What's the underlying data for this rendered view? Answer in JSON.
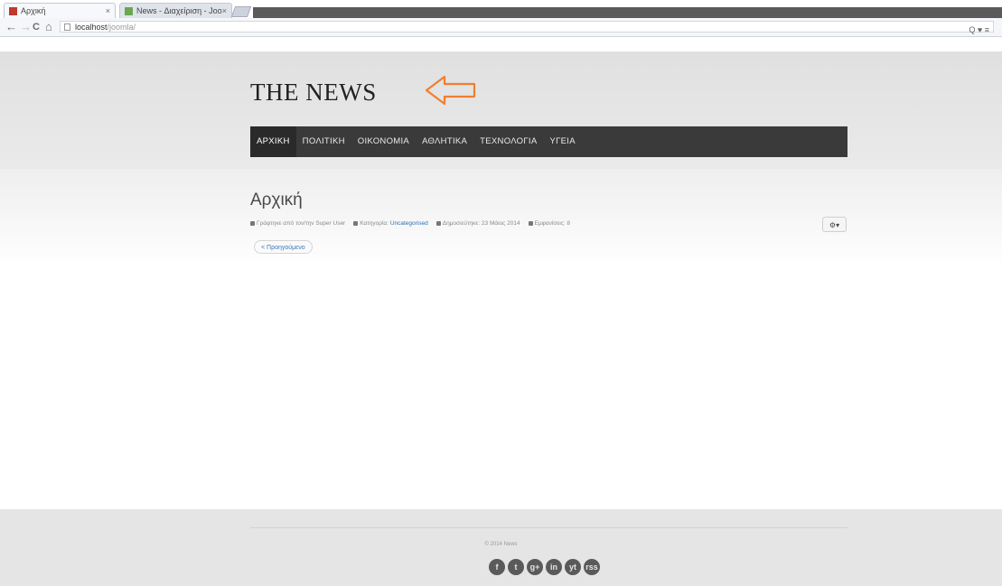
{
  "browser": {
    "tabs": [
      {
        "title": "Αρχική",
        "favicon_color": "#c0392b"
      },
      {
        "title": "News - Διαχείριση - Joo",
        "favicon_color": "#6aa84f"
      }
    ],
    "url_host": "localhost",
    "url_path": "/joomla/",
    "nav": {
      "back": "←",
      "forward": "→",
      "reload": "C",
      "home": "⌂"
    },
    "right_icons": "Q ♥ ≡"
  },
  "site": {
    "logo": "THE NEWS",
    "arrow_color": "#f07f2f",
    "nav": [
      "ΑΡΧΙΚΗ",
      "ΠΟΛΙΤΙΚΗ",
      "ΟΙΚΟΝΟΜΙΑ",
      "ΑΘΛΗΤΙΚΑ",
      "ΤΕΧΝΟΛΟΓΙΑ",
      "ΥΓΕΙΑ"
    ],
    "nav_active": 0
  },
  "article": {
    "title": "Αρχική",
    "meta": {
      "author": "Γράφτηκε από τον/την Super User",
      "category_label": "Κατηγορία:",
      "category_value": "Uncategorised",
      "published": "Δημοσιεύτηκε: 23 Μάιος 2014",
      "hits": "Εμφανίσεις: 8"
    },
    "tools_label": "⚙▾",
    "back_label": "< Προηγούμενο"
  },
  "footer": {
    "copyright": "© 2014 News",
    "social": [
      "f",
      "t",
      "g+",
      "in",
      "yt",
      "rss"
    ]
  }
}
